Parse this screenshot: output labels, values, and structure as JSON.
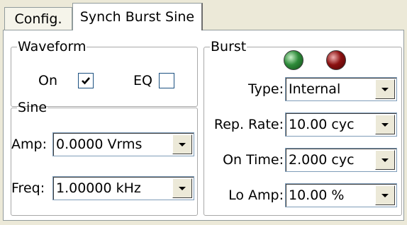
{
  "tabs": [
    {
      "label": "Config.",
      "active": false
    },
    {
      "label": "Synch Burst Sine",
      "active": true
    }
  ],
  "waveform": {
    "legend": "Waveform",
    "on_label": "On",
    "on_checked": true,
    "eq_label": "EQ",
    "eq_checked": false
  },
  "sine": {
    "legend": "Sine",
    "amp_label": "Amp:",
    "amp_value": "0.0000 Vrms",
    "freq_label": "Freq:",
    "freq_value": "1.00000 kHz"
  },
  "burst": {
    "legend": "Burst",
    "led_colors": {
      "green": "#2e8b3a",
      "red": "#8b1010"
    },
    "type_label": "Type:",
    "type_value": "Internal",
    "rep_rate_label": "Rep. Rate:",
    "rep_rate_value": "10.00 cyc",
    "on_time_label": "On Time:",
    "on_time_value": "2.000 cyc",
    "lo_amp_label": "Lo Amp:",
    "lo_amp_value": "10.00 %"
  },
  "icons": {
    "checkmark": "check-icon",
    "dropdown": "chevron-down-icon"
  }
}
